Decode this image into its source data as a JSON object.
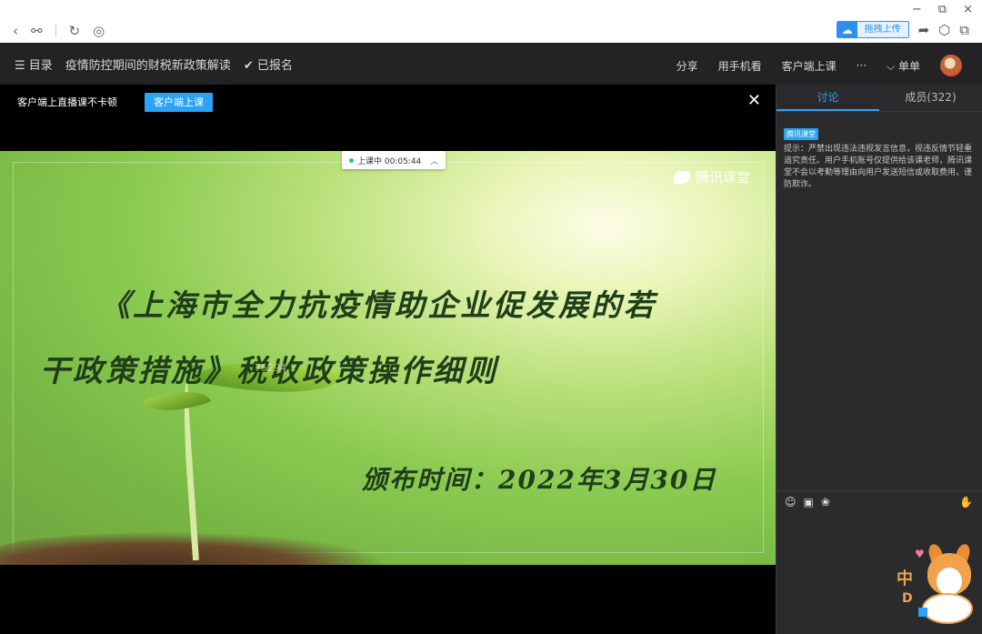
{
  "browser": {
    "nav_icons": [
      "back-icon",
      "link-icon",
      "refresh-icon",
      "globe-icon"
    ],
    "window_controls": {
      "minimize": "−",
      "restore": "⧉",
      "close": "×"
    },
    "upload_label": "拖拽上传",
    "tool_icons": [
      "share-arrow-icon",
      "cube-icon",
      "copy-icon"
    ]
  },
  "topbar": {
    "menu_label": "☰ 目录",
    "course_title": "疫情防控期间的财税新政策解读",
    "registered": "✔ 已报名",
    "actions": [
      "分享",
      "用手机看",
      "客户端上课",
      "···"
    ],
    "view_mode": "⌵ 单单"
  },
  "video": {
    "banner_msg": "客户端上直播课不卡顿",
    "banner_button": "客户端上课",
    "close": "✕",
    "live_status": "上课中 00:05:44",
    "live_chevron": "︿",
    "slide": {
      "brand": "腾讯课堂",
      "title_line1": "《上海市全力抗疫情助企业促发展的若",
      "title_line2": "干政策措施》税收政策操作细则",
      "date_line": "颁布时间：2022年3月30日",
      "watermark": "75294..."
    }
  },
  "panel": {
    "tab_discuss": "讨论",
    "tab_members": "成员(322)",
    "notice_badge": "腾讯课堂",
    "notice_text": "提示：严禁出现违法违规发言信息，视违反情节轻重追究责任。用户手机账号仅提供给该课老师，腾讯课堂不会以考勤等理由向用户发送短信或收取费用，谨防欺诈。",
    "input_icons": {
      "emoji": "☺",
      "image": "▣",
      "flower": "❀",
      "hand": "✋"
    },
    "mascot": {
      "heart": "♥",
      "zhong": "中",
      "dchar": "D"
    }
  }
}
